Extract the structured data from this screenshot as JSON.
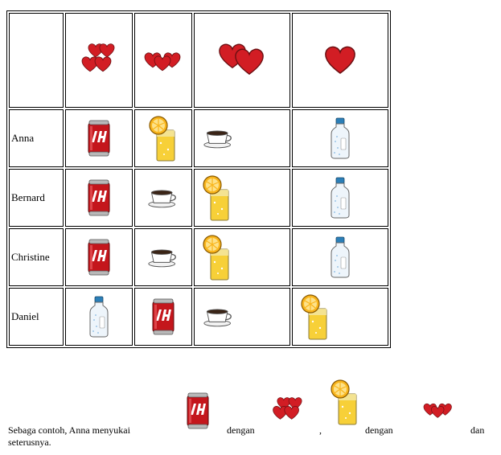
{
  "table": {
    "header_icons": [
      "hearts-four-icon",
      "hearts-three-icon",
      "hearts-two-icon",
      "heart-one-icon"
    ],
    "rows": [
      {
        "name": "Anna",
        "drinks": [
          "soda-can-icon",
          "orange-juice-icon",
          "coffee-cup-icon",
          "water-bottle-icon"
        ]
      },
      {
        "name": "Bernard",
        "drinks": [
          "soda-can-icon",
          "coffee-cup-icon",
          "orange-juice-icon",
          "water-bottle-icon"
        ]
      },
      {
        "name": "Christine",
        "drinks": [
          "soda-can-icon",
          "coffee-cup-icon",
          "orange-juice-icon",
          "water-bottle-icon"
        ]
      },
      {
        "name": "Daniel",
        "drinks": [
          "water-bottle-icon",
          "soda-can-icon",
          "coffee-cup-icon",
          "orange-juice-icon"
        ]
      }
    ]
  },
  "sentence": {
    "part1": "Sebaga contoh, Anna menyukai",
    "dengan1": "dengan",
    "comma": ",",
    "dengan2": "dengan",
    "dan": "dan",
    "line2": "seterusnya."
  },
  "colors": {
    "heart_red": "#d21d24",
    "can_red": "#c4161c",
    "juice_yellow": "#f7d038",
    "bottle_blue": "#2b7fb8"
  }
}
